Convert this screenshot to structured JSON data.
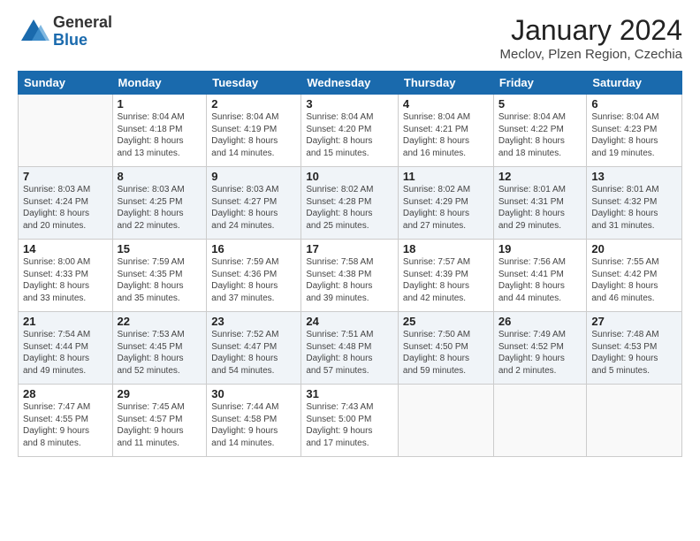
{
  "header": {
    "logo_general": "General",
    "logo_blue": "Blue",
    "title": "January 2024",
    "location": "Meclov, Plzen Region, Czechia"
  },
  "days_of_week": [
    "Sunday",
    "Monday",
    "Tuesday",
    "Wednesday",
    "Thursday",
    "Friday",
    "Saturday"
  ],
  "weeks": [
    [
      {
        "day": "",
        "sunrise": "",
        "sunset": "",
        "daylight": ""
      },
      {
        "day": "1",
        "sunrise": "Sunrise: 8:04 AM",
        "sunset": "Sunset: 4:18 PM",
        "daylight": "Daylight: 8 hours and 13 minutes."
      },
      {
        "day": "2",
        "sunrise": "Sunrise: 8:04 AM",
        "sunset": "Sunset: 4:19 PM",
        "daylight": "Daylight: 8 hours and 14 minutes."
      },
      {
        "day": "3",
        "sunrise": "Sunrise: 8:04 AM",
        "sunset": "Sunset: 4:20 PM",
        "daylight": "Daylight: 8 hours and 15 minutes."
      },
      {
        "day": "4",
        "sunrise": "Sunrise: 8:04 AM",
        "sunset": "Sunset: 4:21 PM",
        "daylight": "Daylight: 8 hours and 16 minutes."
      },
      {
        "day": "5",
        "sunrise": "Sunrise: 8:04 AM",
        "sunset": "Sunset: 4:22 PM",
        "daylight": "Daylight: 8 hours and 18 minutes."
      },
      {
        "day": "6",
        "sunrise": "Sunrise: 8:04 AM",
        "sunset": "Sunset: 4:23 PM",
        "daylight": "Daylight: 8 hours and 19 minutes."
      }
    ],
    [
      {
        "day": "7",
        "sunrise": "Sunrise: 8:03 AM",
        "sunset": "Sunset: 4:24 PM",
        "daylight": "Daylight: 8 hours and 20 minutes."
      },
      {
        "day": "8",
        "sunrise": "Sunrise: 8:03 AM",
        "sunset": "Sunset: 4:25 PM",
        "daylight": "Daylight: 8 hours and 22 minutes."
      },
      {
        "day": "9",
        "sunrise": "Sunrise: 8:03 AM",
        "sunset": "Sunset: 4:27 PM",
        "daylight": "Daylight: 8 hours and 24 minutes."
      },
      {
        "day": "10",
        "sunrise": "Sunrise: 8:02 AM",
        "sunset": "Sunset: 4:28 PM",
        "daylight": "Daylight: 8 hours and 25 minutes."
      },
      {
        "day": "11",
        "sunrise": "Sunrise: 8:02 AM",
        "sunset": "Sunset: 4:29 PM",
        "daylight": "Daylight: 8 hours and 27 minutes."
      },
      {
        "day": "12",
        "sunrise": "Sunrise: 8:01 AM",
        "sunset": "Sunset: 4:31 PM",
        "daylight": "Daylight: 8 hours and 29 minutes."
      },
      {
        "day": "13",
        "sunrise": "Sunrise: 8:01 AM",
        "sunset": "Sunset: 4:32 PM",
        "daylight": "Daylight: 8 hours and 31 minutes."
      }
    ],
    [
      {
        "day": "14",
        "sunrise": "Sunrise: 8:00 AM",
        "sunset": "Sunset: 4:33 PM",
        "daylight": "Daylight: 8 hours and 33 minutes."
      },
      {
        "day": "15",
        "sunrise": "Sunrise: 7:59 AM",
        "sunset": "Sunset: 4:35 PM",
        "daylight": "Daylight: 8 hours and 35 minutes."
      },
      {
        "day": "16",
        "sunrise": "Sunrise: 7:59 AM",
        "sunset": "Sunset: 4:36 PM",
        "daylight": "Daylight: 8 hours and 37 minutes."
      },
      {
        "day": "17",
        "sunrise": "Sunrise: 7:58 AM",
        "sunset": "Sunset: 4:38 PM",
        "daylight": "Daylight: 8 hours and 39 minutes."
      },
      {
        "day": "18",
        "sunrise": "Sunrise: 7:57 AM",
        "sunset": "Sunset: 4:39 PM",
        "daylight": "Daylight: 8 hours and 42 minutes."
      },
      {
        "day": "19",
        "sunrise": "Sunrise: 7:56 AM",
        "sunset": "Sunset: 4:41 PM",
        "daylight": "Daylight: 8 hours and 44 minutes."
      },
      {
        "day": "20",
        "sunrise": "Sunrise: 7:55 AM",
        "sunset": "Sunset: 4:42 PM",
        "daylight": "Daylight: 8 hours and 46 minutes."
      }
    ],
    [
      {
        "day": "21",
        "sunrise": "Sunrise: 7:54 AM",
        "sunset": "Sunset: 4:44 PM",
        "daylight": "Daylight: 8 hours and 49 minutes."
      },
      {
        "day": "22",
        "sunrise": "Sunrise: 7:53 AM",
        "sunset": "Sunset: 4:45 PM",
        "daylight": "Daylight: 8 hours and 52 minutes."
      },
      {
        "day": "23",
        "sunrise": "Sunrise: 7:52 AM",
        "sunset": "Sunset: 4:47 PM",
        "daylight": "Daylight: 8 hours and 54 minutes."
      },
      {
        "day": "24",
        "sunrise": "Sunrise: 7:51 AM",
        "sunset": "Sunset: 4:48 PM",
        "daylight": "Daylight: 8 hours and 57 minutes."
      },
      {
        "day": "25",
        "sunrise": "Sunrise: 7:50 AM",
        "sunset": "Sunset: 4:50 PM",
        "daylight": "Daylight: 8 hours and 59 minutes."
      },
      {
        "day": "26",
        "sunrise": "Sunrise: 7:49 AM",
        "sunset": "Sunset: 4:52 PM",
        "daylight": "Daylight: 9 hours and 2 minutes."
      },
      {
        "day": "27",
        "sunrise": "Sunrise: 7:48 AM",
        "sunset": "Sunset: 4:53 PM",
        "daylight": "Daylight: 9 hours and 5 minutes."
      }
    ],
    [
      {
        "day": "28",
        "sunrise": "Sunrise: 7:47 AM",
        "sunset": "Sunset: 4:55 PM",
        "daylight": "Daylight: 9 hours and 8 minutes."
      },
      {
        "day": "29",
        "sunrise": "Sunrise: 7:45 AM",
        "sunset": "Sunset: 4:57 PM",
        "daylight": "Daylight: 9 hours and 11 minutes."
      },
      {
        "day": "30",
        "sunrise": "Sunrise: 7:44 AM",
        "sunset": "Sunset: 4:58 PM",
        "daylight": "Daylight: 9 hours and 14 minutes."
      },
      {
        "day": "31",
        "sunrise": "Sunrise: 7:43 AM",
        "sunset": "Sunset: 5:00 PM",
        "daylight": "Daylight: 9 hours and 17 minutes."
      },
      {
        "day": "",
        "sunrise": "",
        "sunset": "",
        "daylight": ""
      },
      {
        "day": "",
        "sunrise": "",
        "sunset": "",
        "daylight": ""
      },
      {
        "day": "",
        "sunrise": "",
        "sunset": "",
        "daylight": ""
      }
    ]
  ]
}
